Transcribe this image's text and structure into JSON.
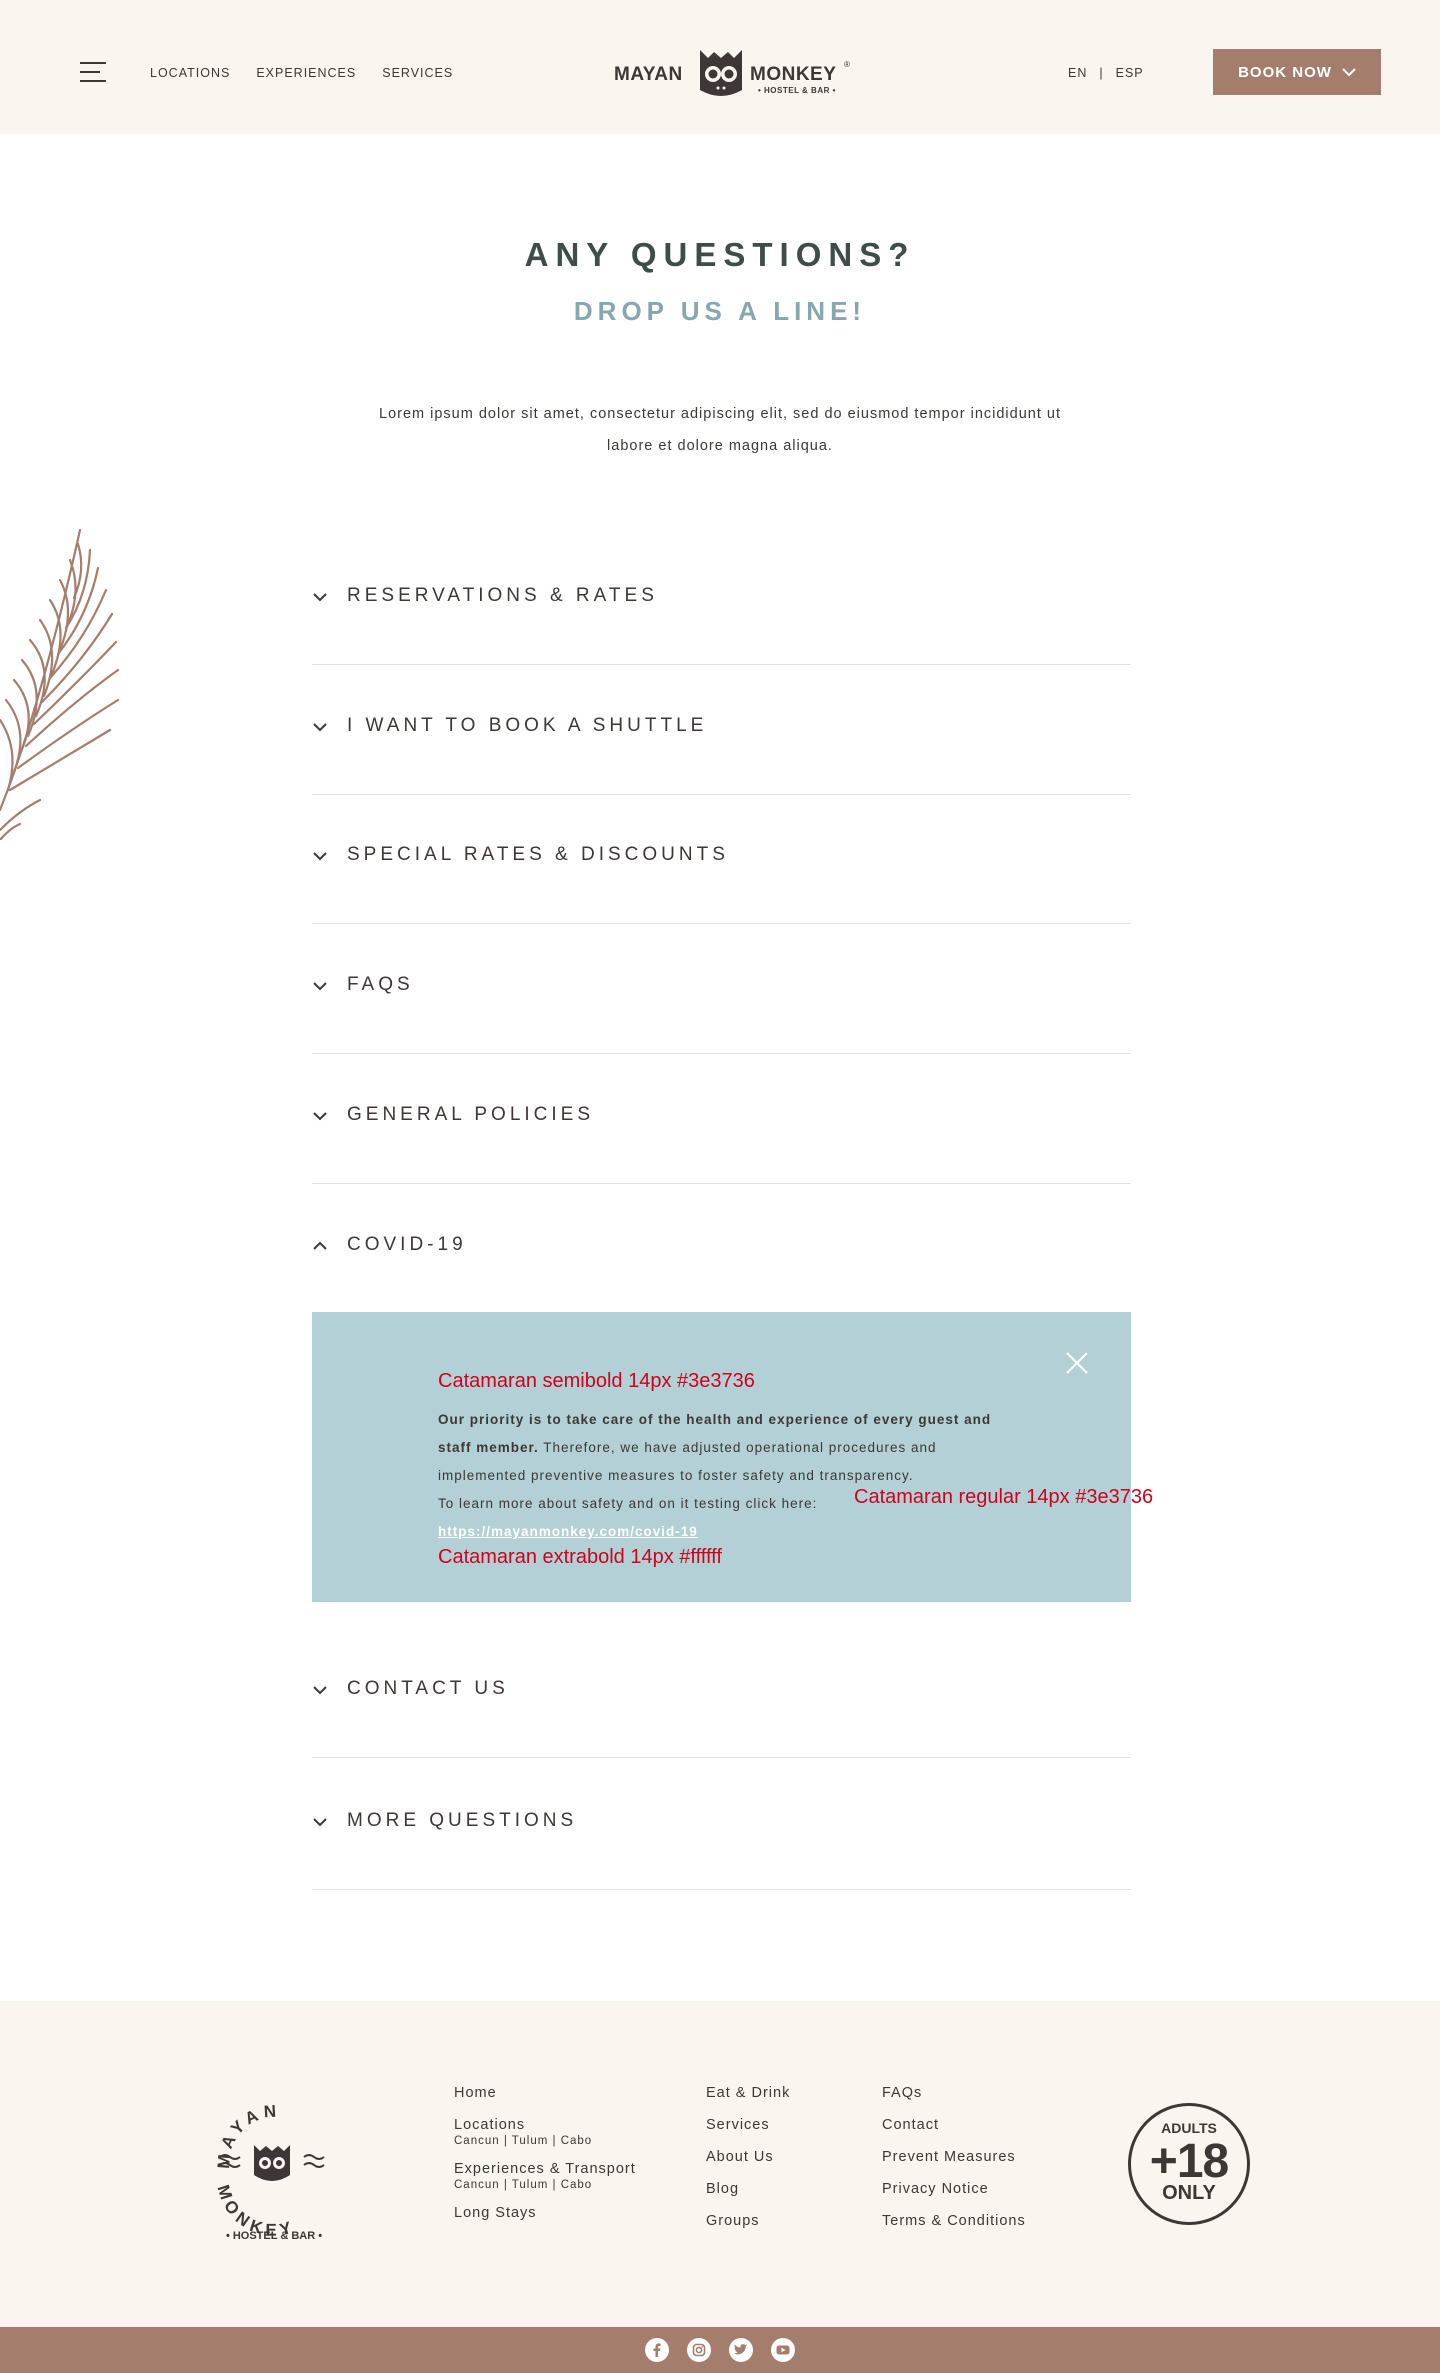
{
  "header": {
    "nav": [
      "LOCATIONS",
      "EXPERIENCES",
      "SERVICES"
    ],
    "logo": {
      "word1": "MAYAN",
      "word2": "MONKEY",
      "tagline": "• HOSTEL & BAR •",
      "reg": "®"
    },
    "lang": {
      "en": "EN",
      "sep": "|",
      "esp": "ESP"
    },
    "book_label": "BOOK NOW"
  },
  "hero": {
    "title": "ANY QUESTIONS?",
    "subtitle": "DROP US A LINE!",
    "intro": "Lorem ipsum dolor sit amet, consectetur adipiscing elit, sed do eiusmod tempor incididunt ut labore et dolore magna aliqua."
  },
  "accordion": {
    "items": [
      {
        "label": "RESERVATIONS & RATES",
        "open": false
      },
      {
        "label": "I WANT TO BOOK A SHUTTLE",
        "open": false
      },
      {
        "label": "SPECIAL RATES & DISCOUNTS",
        "open": false
      },
      {
        "label": "FAQS",
        "open": false
      },
      {
        "label": "GENERAL POLICIES",
        "open": false
      },
      {
        "label": "COVID-19",
        "open": true
      },
      {
        "label": "CONTACT US",
        "open": false
      },
      {
        "label": "MORE QUESTIONS",
        "open": false
      }
    ],
    "covid_panel": {
      "bold_text": "Our priority is to take care of the health and experience of every guest and staff member.",
      "text": " Therefore, we have adjusted operational procedures and implemented preventive measures to foster safety and transparency.",
      "link_intro": "To learn more about safety and on it testing click here:",
      "link": "https://mayanmonkey.com/covid-19",
      "annotations": {
        "semibold": "Catamaran semibold 14px #3e3736",
        "regular": "Catamaran regular 14px #3e3736",
        "extrabold": "Catamaran extrabold 14px #ffffff"
      },
      "panel_color": "#b2d0d5"
    }
  },
  "footer": {
    "logo": {
      "word1": "MAYAN",
      "word2": "MONKEY",
      "tagline": "• HOSTEL & BAR •"
    },
    "col1": {
      "home": "Home",
      "locations": "Locations",
      "locations_sub": "Cancun | Tulum | Cabo",
      "experiences": "Experiences & Transport",
      "experiences_sub": "Cancun | Tulum | Cabo",
      "long_stays": "Long Stays"
    },
    "col2": [
      "Eat & Drink",
      "Services",
      "About Us",
      "Blog",
      "Groups"
    ],
    "col3": [
      "FAQs",
      "Contact",
      "Prevent Measures",
      "Privacy Notice",
      "Terms & Conditions"
    ],
    "badge": {
      "top": "ADULTS",
      "mid": "+18",
      "bottom": "ONLY"
    },
    "social": [
      "facebook-icon",
      "instagram-icon",
      "twitter-icon",
      "youtube-icon"
    ]
  },
  "colors": {
    "brand": "#a57d6c",
    "dark": "#3e3736",
    "accent_blue": "#85a7b0",
    "panel": "#b2d0d5",
    "annotation": "#d0021b"
  }
}
